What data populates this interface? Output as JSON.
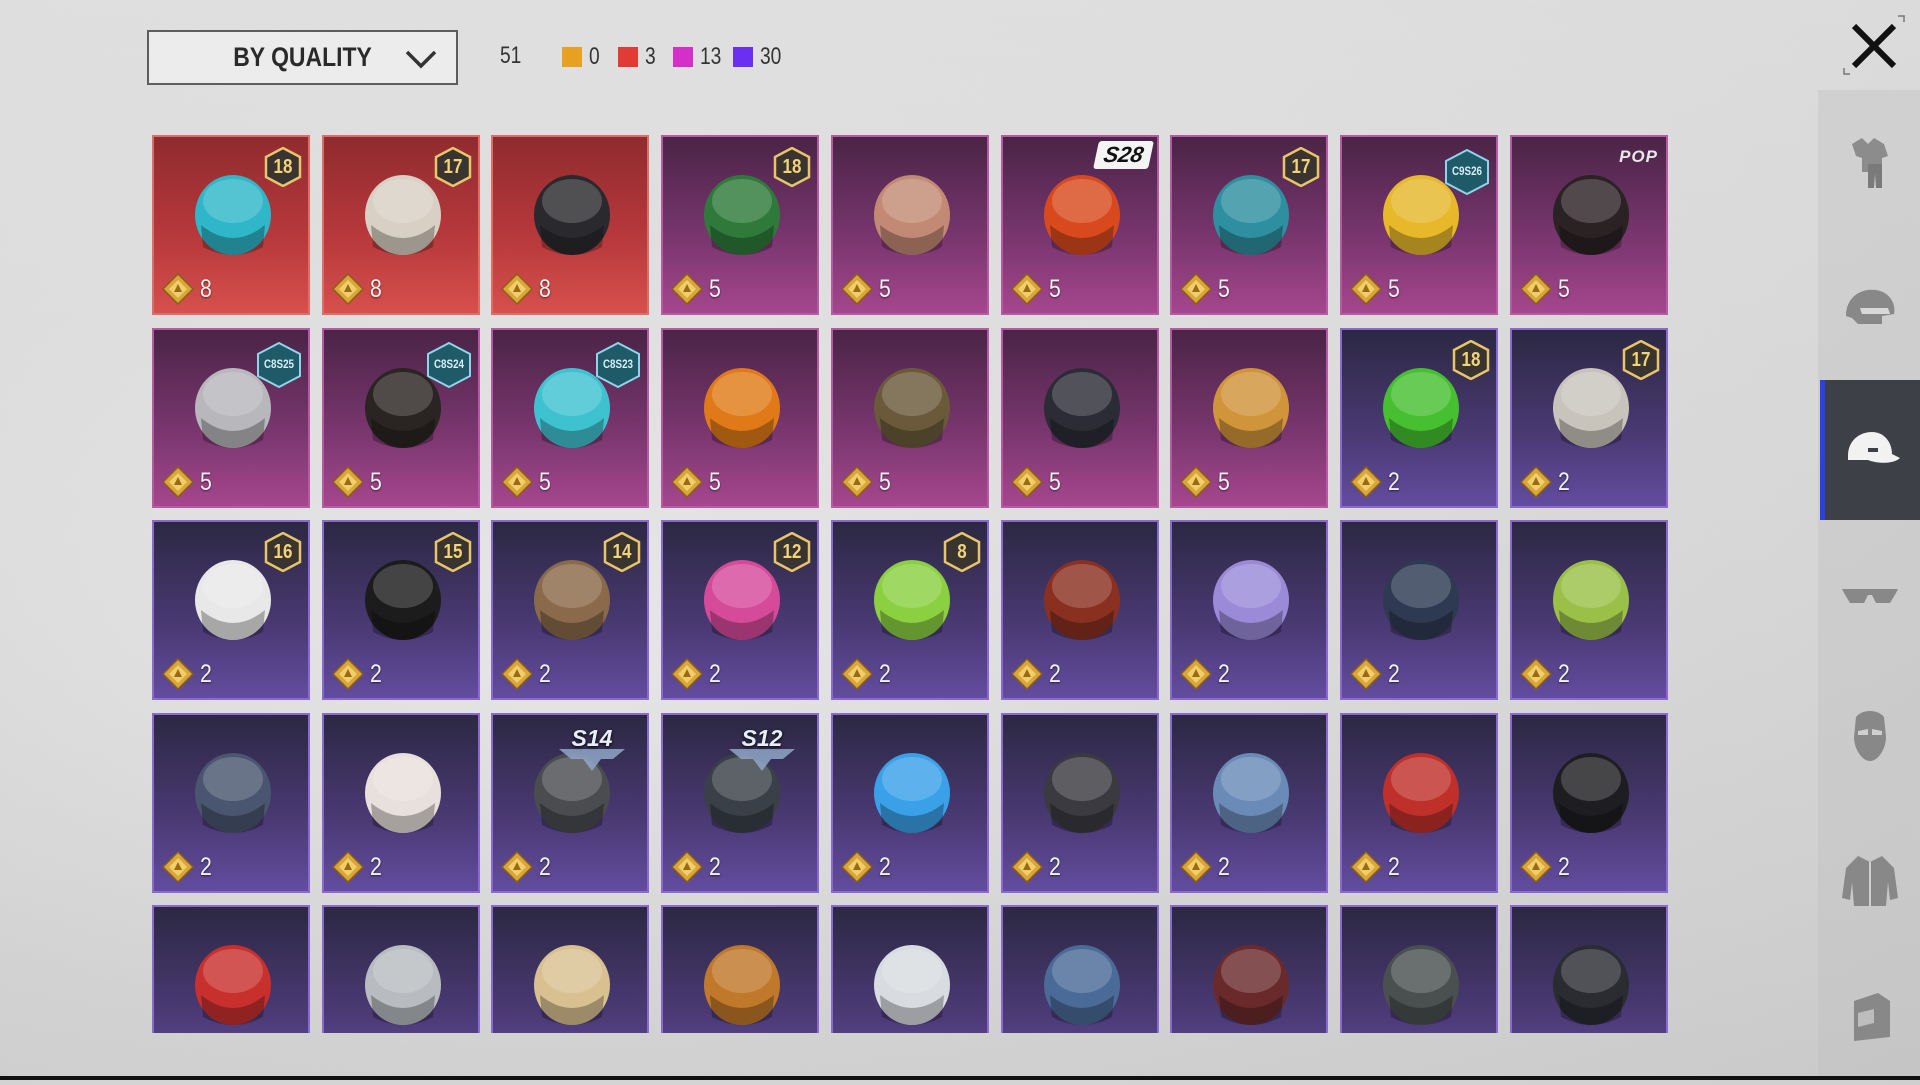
{
  "toolbar": {
    "sort_label": "BY QUALITY",
    "total_count": "51",
    "quality_counts": [
      {
        "color": "#e8a020",
        "count": "0"
      },
      {
        "color": "#e23b35",
        "count": "3"
      },
      {
        "color": "#d42fc8",
        "count": "13"
      },
      {
        "color": "#6a2ff0",
        "count": "30"
      }
    ]
  },
  "categories": [
    {
      "name": "outfit",
      "icon": "outfit-icon",
      "active": false
    },
    {
      "name": "helmet",
      "icon": "helmet-icon",
      "active": false
    },
    {
      "name": "headwear",
      "icon": "cap-icon",
      "active": true
    },
    {
      "name": "eyewear",
      "icon": "glasses-icon",
      "active": false
    },
    {
      "name": "mask",
      "icon": "mask-icon",
      "active": false
    },
    {
      "name": "jacket",
      "icon": "jacket-icon",
      "active": false
    },
    {
      "name": "backpack",
      "icon": "backpack-icon",
      "active": false
    }
  ],
  "items": [
    {
      "quality": "red",
      "price": "8",
      "badge": {
        "type": "num",
        "text": "18"
      },
      "icon": "winged-mask-headwear-icon",
      "color": "#2fb6c8"
    },
    {
      "quality": "red",
      "price": "8",
      "badge": {
        "type": "num",
        "text": "17"
      },
      "icon": "skull-headdress-icon",
      "color": "#d8d0c4"
    },
    {
      "quality": "red",
      "price": "8",
      "badge": null,
      "icon": "black-visor-helmet-icon",
      "color": "#2a2a2e"
    },
    {
      "quality": "pink",
      "price": "5",
      "badge": {
        "type": "num",
        "text": "18"
      },
      "icon": "green-beanie-icon",
      "color": "#2f7a3a"
    },
    {
      "quality": "pink",
      "price": "5",
      "badge": null,
      "icon": "long-hair-icon",
      "color": "#c28a74"
    },
    {
      "quality": "pink",
      "price": "5",
      "badge": {
        "type": "tag",
        "text": "S28"
      },
      "icon": "orange-crown-icon",
      "color": "#d84a1e"
    },
    {
      "quality": "pink",
      "price": "5",
      "badge": {
        "type": "num",
        "text": "17"
      },
      "icon": "teal-cap-blonde-icon",
      "color": "#2e8fa0"
    },
    {
      "quality": "pink",
      "price": "5",
      "badge": {
        "type": "hex",
        "text": "C9S26"
      },
      "icon": "yellow-creature-hat-icon",
      "color": "#e6b82a"
    },
    {
      "quality": "pink",
      "price": "5",
      "badge": {
        "type": "pop",
        "text": "POP"
      },
      "icon": "dark-ponytail-icon",
      "color": "#2b2224"
    },
    {
      "quality": "pink",
      "price": "5",
      "badge": {
        "type": "hex",
        "text": "C8S25"
      },
      "icon": "silver-hair-icon",
      "color": "#b8b8bc"
    },
    {
      "quality": "pink",
      "price": "5",
      "badge": {
        "type": "hex",
        "text": "C8S24"
      },
      "icon": "black-bob-hair-icon",
      "color": "#2a2422"
    },
    {
      "quality": "pink",
      "price": "5",
      "badge": {
        "type": "hex",
        "text": "C8S23"
      },
      "icon": "cat-headphones-icon",
      "color": "#3fc2d0"
    },
    {
      "quality": "pink",
      "price": "5",
      "badge": null,
      "icon": "pumpkin-head-icon",
      "color": "#e07a18"
    },
    {
      "quality": "pink",
      "price": "5",
      "badge": null,
      "icon": "cowboy-robot-icon",
      "color": "#6a5a3a"
    },
    {
      "quality": "pink",
      "price": "5",
      "badge": null,
      "icon": "dark-mask-helmet-icon",
      "color": "#2c2c36"
    },
    {
      "quality": "pink",
      "price": "5",
      "badge": null,
      "icon": "ornate-helmet-icon",
      "color": "#d0943a"
    },
    {
      "quality": "purple",
      "price": "2",
      "badge": {
        "type": "num",
        "text": "18"
      },
      "icon": "green-beanie-goggles-icon",
      "color": "#46c030"
    },
    {
      "quality": "purple",
      "price": "2",
      "badge": {
        "type": "num",
        "text": "17"
      },
      "icon": "spiked-helmet-icon",
      "color": "#c8c4bc"
    },
    {
      "quality": "purple",
      "price": "2",
      "badge": {
        "type": "num",
        "text": "16"
      },
      "icon": "striped-beanie-icon",
      "color": "#e8e8e8"
    },
    {
      "quality": "purple",
      "price": "2",
      "badge": {
        "type": "num",
        "text": "15"
      },
      "icon": "jack-o-beanie-icon",
      "color": "#1c1c1c"
    },
    {
      "quality": "purple",
      "price": "2",
      "badge": {
        "type": "num",
        "text": "14"
      },
      "icon": "cat-ear-hair-icon",
      "color": "#8a6a4a"
    },
    {
      "quality": "purple",
      "price": "2",
      "badge": {
        "type": "num",
        "text": "12"
      },
      "icon": "bunny-helmet-icon",
      "color": "#d64a9a"
    },
    {
      "quality": "purple",
      "price": "2",
      "badge": {
        "type": "num",
        "text": "8"
      },
      "icon": "green-skull-hood-icon",
      "color": "#8ad040"
    },
    {
      "quality": "purple",
      "price": "2",
      "badge": null,
      "icon": "red-hair-goggles-icon",
      "color": "#8a3020"
    },
    {
      "quality": "purple",
      "price": "2",
      "badge": null,
      "icon": "galaxy-cap-icon",
      "color": "#9a8ad8"
    },
    {
      "quality": "purple",
      "price": "2",
      "badge": null,
      "icon": "navy-beanie-icon",
      "color": "#2e3a52"
    },
    {
      "quality": "purple",
      "price": "2",
      "badge": null,
      "icon": "green-black-cap-icon",
      "color": "#9ac048"
    },
    {
      "quality": "purple",
      "price": "2",
      "badge": null,
      "icon": "slate-cap-icon",
      "color": "#4a5670"
    },
    {
      "quality": "purple",
      "price": "2",
      "badge": null,
      "icon": "kabuki-mask-icon",
      "color": "#e8e0dc"
    },
    {
      "quality": "purple",
      "price": "2",
      "badge": {
        "type": "season",
        "text": "S14"
      },
      "icon": "gladiator-helmet-icon",
      "color": "#4a4c50"
    },
    {
      "quality": "purple",
      "price": "2",
      "badge": {
        "type": "season",
        "text": "S12"
      },
      "icon": "space-helmet-icon",
      "color": "#3a4048"
    },
    {
      "quality": "purple",
      "price": "2",
      "badge": null,
      "icon": "blue-bunny-headband-icon",
      "color": "#3aa0e8"
    },
    {
      "quality": "purple",
      "price": "2",
      "badge": null,
      "icon": "black-tactical-helmet-icon",
      "color": "#3a3a40"
    },
    {
      "quality": "purple",
      "price": "2",
      "badge": null,
      "icon": "shark-hat-icon",
      "color": "#6a8ab8"
    },
    {
      "quality": "purple",
      "price": "2",
      "badge": null,
      "icon": "red-beret-icon",
      "color": "#c0302a"
    },
    {
      "quality": "purple",
      "price": "2",
      "badge": null,
      "icon": "black-top-hat-icon",
      "color": "#1e1e22"
    },
    {
      "quality": "purple",
      "price": "",
      "badge": null,
      "icon": "red-fedora-icon",
      "color": "#c8302e"
    },
    {
      "quality": "purple",
      "price": "",
      "badge": null,
      "icon": "grey-shark-head-icon",
      "color": "#b8bcc0"
    },
    {
      "quality": "purple",
      "price": "",
      "badge": null,
      "icon": "cake-hat-icon",
      "color": "#d8c090"
    },
    {
      "quality": "purple",
      "price": "",
      "badge": null,
      "icon": "burger-hat-icon",
      "color": "#c0782a"
    },
    {
      "quality": "purple",
      "price": "",
      "badge": null,
      "icon": "headlamp-icon",
      "color": "#d8dce0"
    },
    {
      "quality": "purple",
      "price": "",
      "badge": null,
      "icon": "blue-garrison-cap-icon",
      "color": "#4a6a98"
    },
    {
      "quality": "purple",
      "price": "",
      "badge": null,
      "icon": "maroon-fedora-icon",
      "color": "#6a2a2c"
    },
    {
      "quality": "purple",
      "price": "",
      "badge": null,
      "icon": "plaid-helmet-icon",
      "color": "#4a5050"
    },
    {
      "quality": "purple",
      "price": "",
      "badge": null,
      "icon": "bucket-hat-icon",
      "color": "#2a2c32"
    }
  ]
}
